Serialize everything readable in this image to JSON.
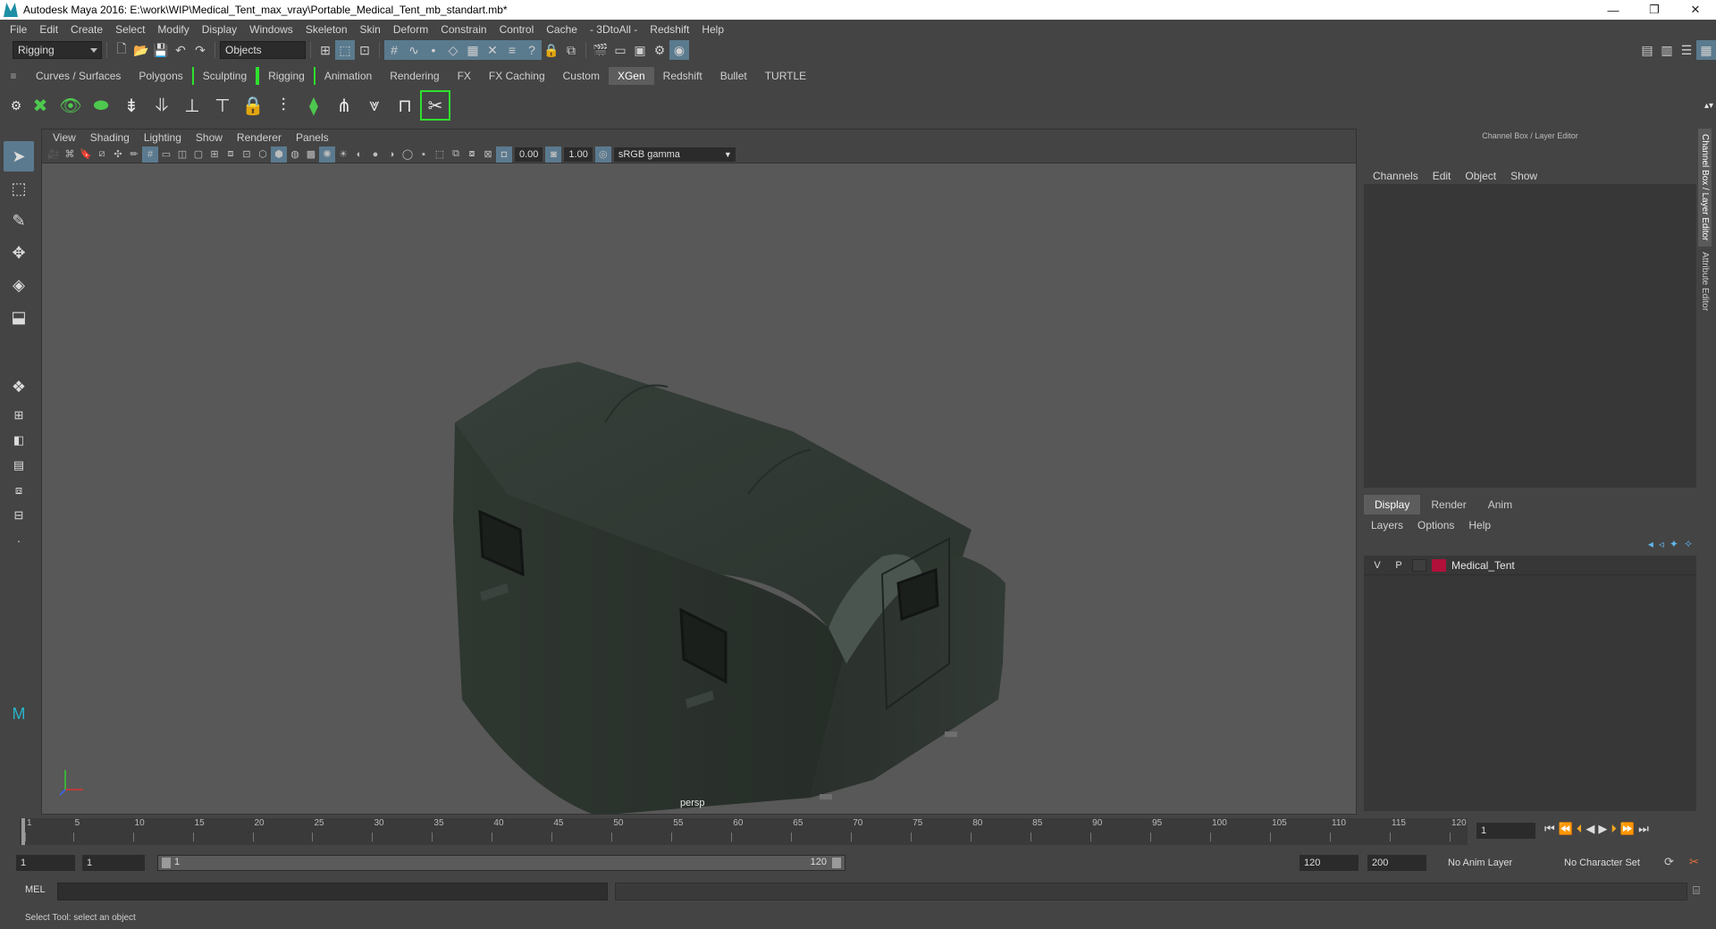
{
  "window": {
    "title": "Autodesk Maya 2016: E:\\work\\WIP\\Medical_Tent_max_vray\\Portable_Medical_Tent_mb_standart.mb*",
    "minimize": "—",
    "restore": "❐",
    "close": "✕"
  },
  "menubar": {
    "items": [
      "File",
      "Edit",
      "Create",
      "Select",
      "Modify",
      "Display",
      "Windows",
      "Skeleton",
      "Skin",
      "Deform",
      "Constrain",
      "Control",
      "Cache",
      "- 3DtoAll -",
      "Redshift",
      "Help"
    ]
  },
  "statusline": {
    "mode_menu": "Rigging",
    "select_mode": "Objects"
  },
  "shelf": {
    "tabs": [
      {
        "label": "Curves / Surfaces"
      },
      {
        "label": "Polygons"
      },
      {
        "label": "Sculpting"
      },
      {
        "label": "Rigging"
      },
      {
        "label": "Animation"
      },
      {
        "label": "Rendering"
      },
      {
        "label": "FX"
      },
      {
        "label": "FX Caching"
      },
      {
        "label": "Custom"
      },
      {
        "label": "XGen"
      },
      {
        "label": "Redshift"
      },
      {
        "label": "Bullet"
      },
      {
        "label": "TURTLE"
      }
    ],
    "active_tab": "XGen",
    "hamburger_icon": "≡"
  },
  "viewport": {
    "menus": [
      "View",
      "Shading",
      "Lighting",
      "Show",
      "Renderer",
      "Panels"
    ],
    "exposure": "0.00",
    "gamma": "1.00",
    "color_space": "sRGB gamma",
    "camera_label": "persp"
  },
  "right_panel": {
    "title": "Channel Box / Layer Editor",
    "menus": [
      "Channels",
      "Edit",
      "Object",
      "Show"
    ],
    "layer_tabs": [
      "Display",
      "Render",
      "Anim"
    ],
    "active_layer_tab": "Display",
    "layer_menus": [
      "Layers",
      "Options",
      "Help"
    ],
    "layers": [
      {
        "v": "V",
        "p": "P",
        "name": "Medical_Tent",
        "color": "#b0103a"
      }
    ],
    "side_tabs": [
      "Channel Box / Layer Editor",
      "Attribute Editor"
    ]
  },
  "timeline": {
    "ticks": [
      "1",
      "5",
      "10",
      "15",
      "20",
      "25",
      "30",
      "35",
      "40",
      "45",
      "50",
      "55",
      "60",
      "65",
      "70",
      "75",
      "80",
      "85",
      "90",
      "95",
      "100",
      "105",
      "110",
      "115",
      "120"
    ],
    "current_frame": "1"
  },
  "range": {
    "start": "1",
    "playback_start": "1",
    "range_low": "1",
    "range_high": "120",
    "playback_end": "120",
    "end": "200",
    "anim_layer": "No Anim Layer",
    "character_set": "No Character Set"
  },
  "cmdline": {
    "label": "MEL"
  },
  "help": {
    "text": "Select Tool: select an object"
  },
  "colors": {
    "accent": "#5b7a8f",
    "shelf_bracket": "#2fe02f",
    "tent": "#2e3530",
    "layer": "#b0103a"
  }
}
